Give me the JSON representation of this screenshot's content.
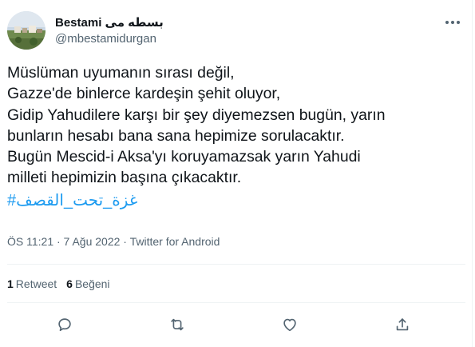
{
  "user": {
    "display_name": "Bestami بسطه مى",
    "handle": "@mbestamidurgan"
  },
  "tweet": {
    "lines": [
      "Müslüman uyumanın sırası değil,",
      "Gazze'de binlerce kardeşin şehit oluyor,",
      "Gidip Yahudilere karşı bir şey diyemezsen bugün, yarın",
      "bunların hesabı bana sana hepimize sorulacaktır.",
      "Bugün Mescid-i Aksa'yı koruyamazsak yarın Yahudi",
      "milleti hepimizin başına çıkacaktır."
    ],
    "hashtag": "#غزة_تحت_القصف"
  },
  "meta": {
    "time": "ÖS 11:21 · 7 Ağu 2022 · Twitter for Android"
  },
  "stats": {
    "retweets_count": "1",
    "retweets_label": "Retweet",
    "likes_count": "6",
    "likes_label": "Beğeni"
  },
  "actions": {
    "icons": [
      "reply-icon",
      "retweet-icon",
      "like-icon",
      "share-icon"
    ]
  },
  "colors": {
    "text": "#0f1419",
    "secondary": "#536471",
    "link": "#1d9bf0",
    "divider": "#eff3f4"
  }
}
